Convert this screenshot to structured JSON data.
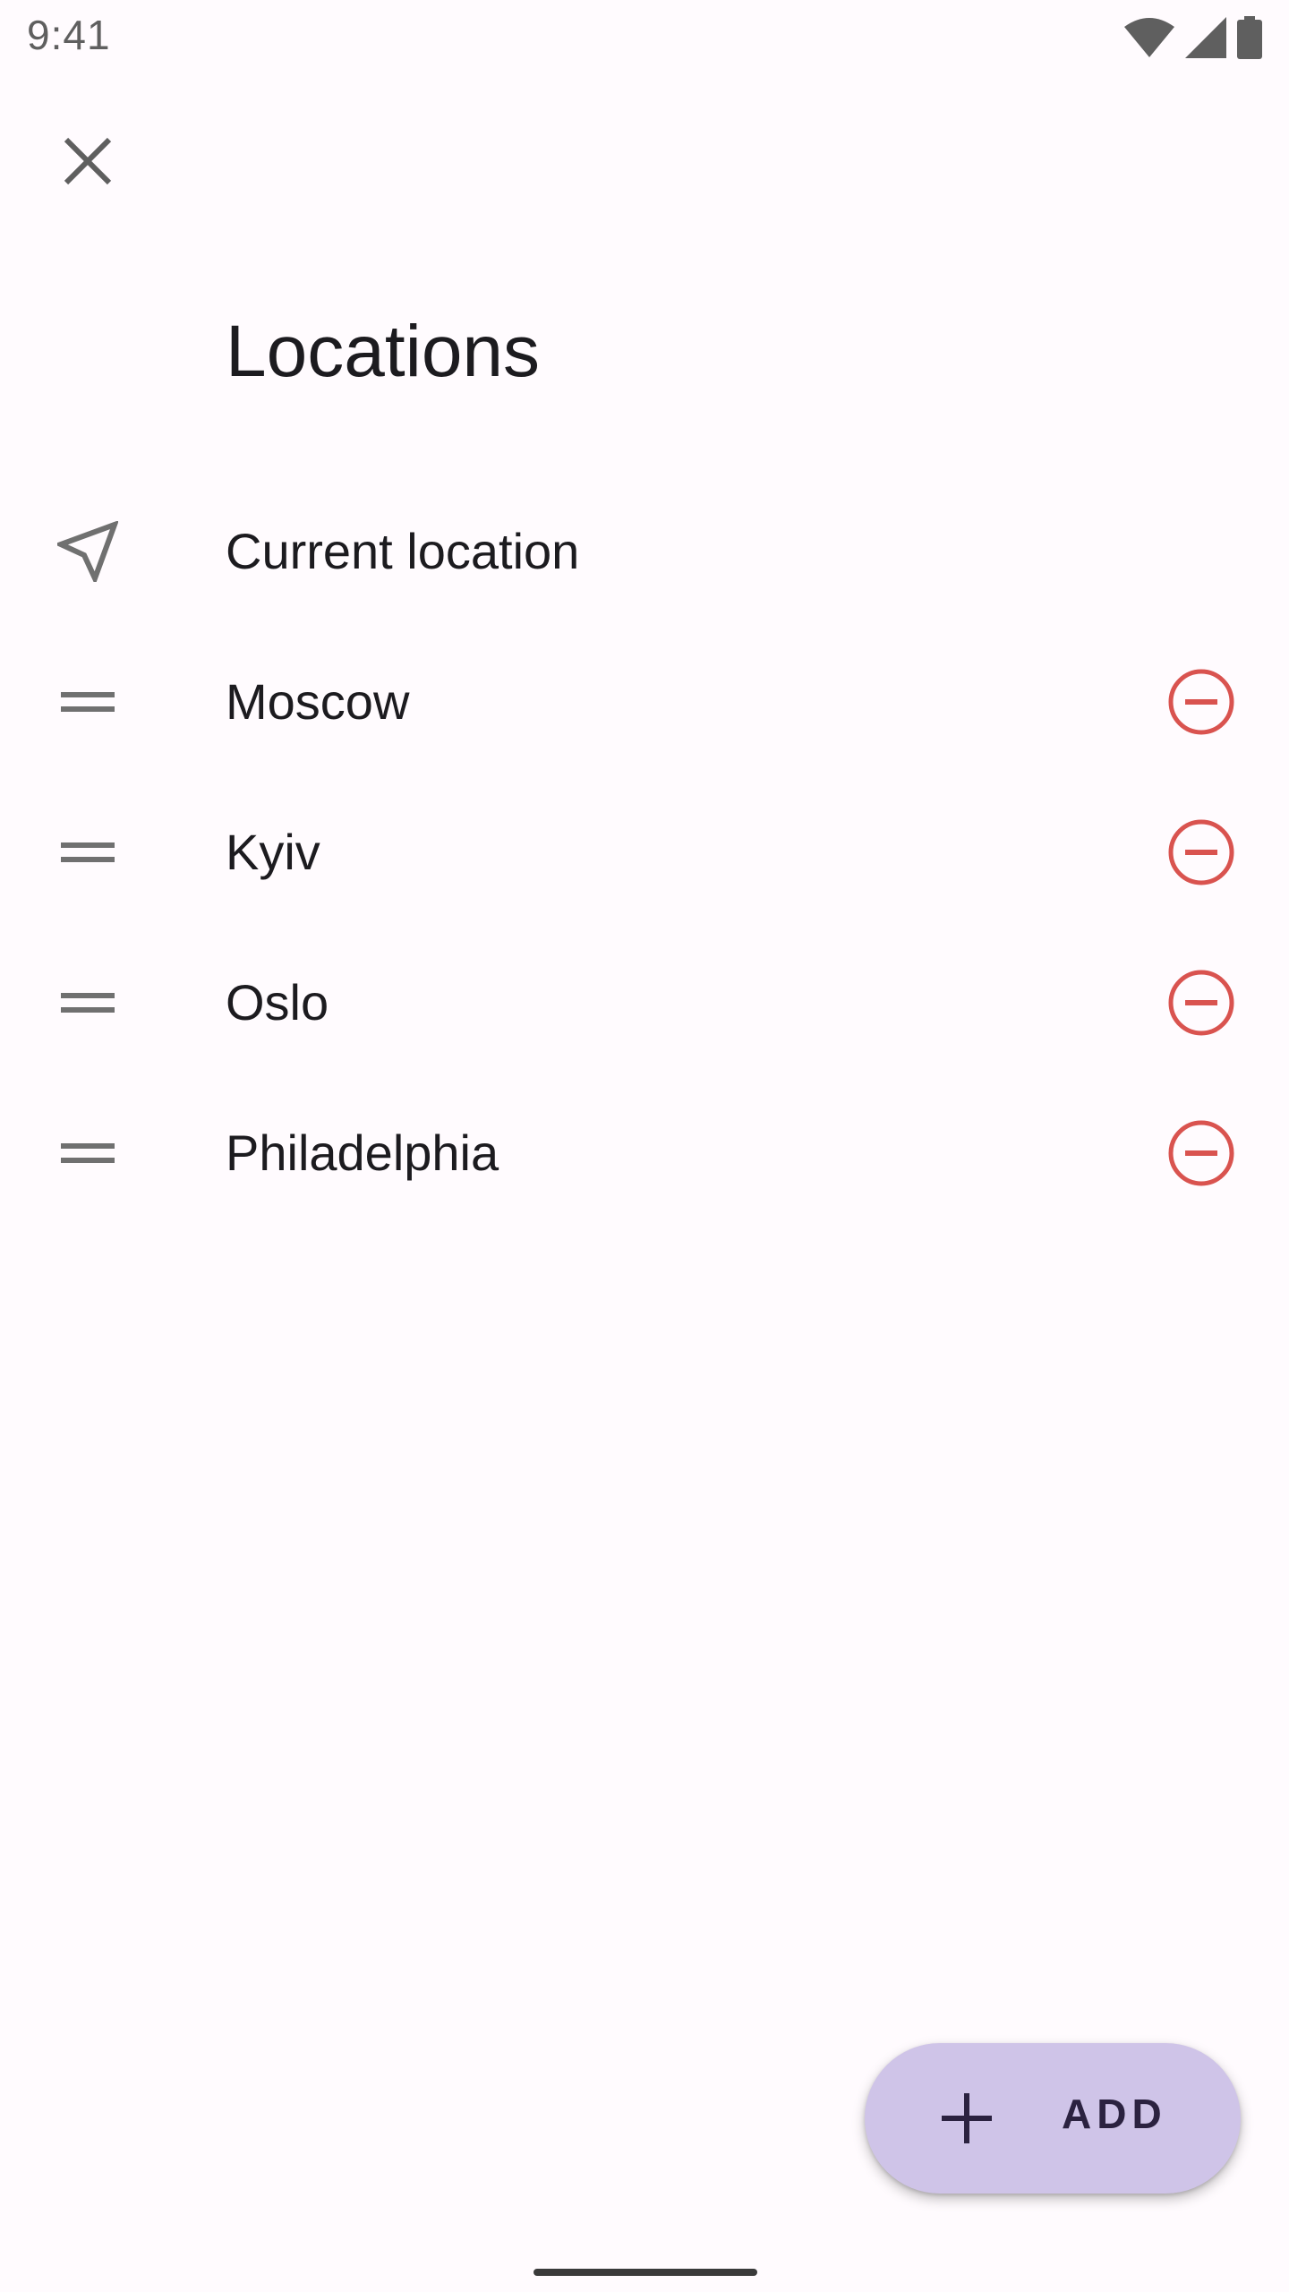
{
  "status_bar": {
    "time": "9:41"
  },
  "header": {
    "close_icon": "close-icon"
  },
  "page": {
    "title": "Locations"
  },
  "current_location": {
    "label": "Current location",
    "icon": "navigation-arrow-icon"
  },
  "locations": [
    {
      "label": "Moscow"
    },
    {
      "label": "Kyiv"
    },
    {
      "label": "Oslo"
    },
    {
      "label": "Philadelphia"
    }
  ],
  "fab": {
    "label": "ADD",
    "icon": "plus-icon"
  },
  "colors": {
    "background": "#fffbfe",
    "remove": "#d9534f",
    "fab": "#cfc4e8",
    "icon_gray": "#707070"
  }
}
